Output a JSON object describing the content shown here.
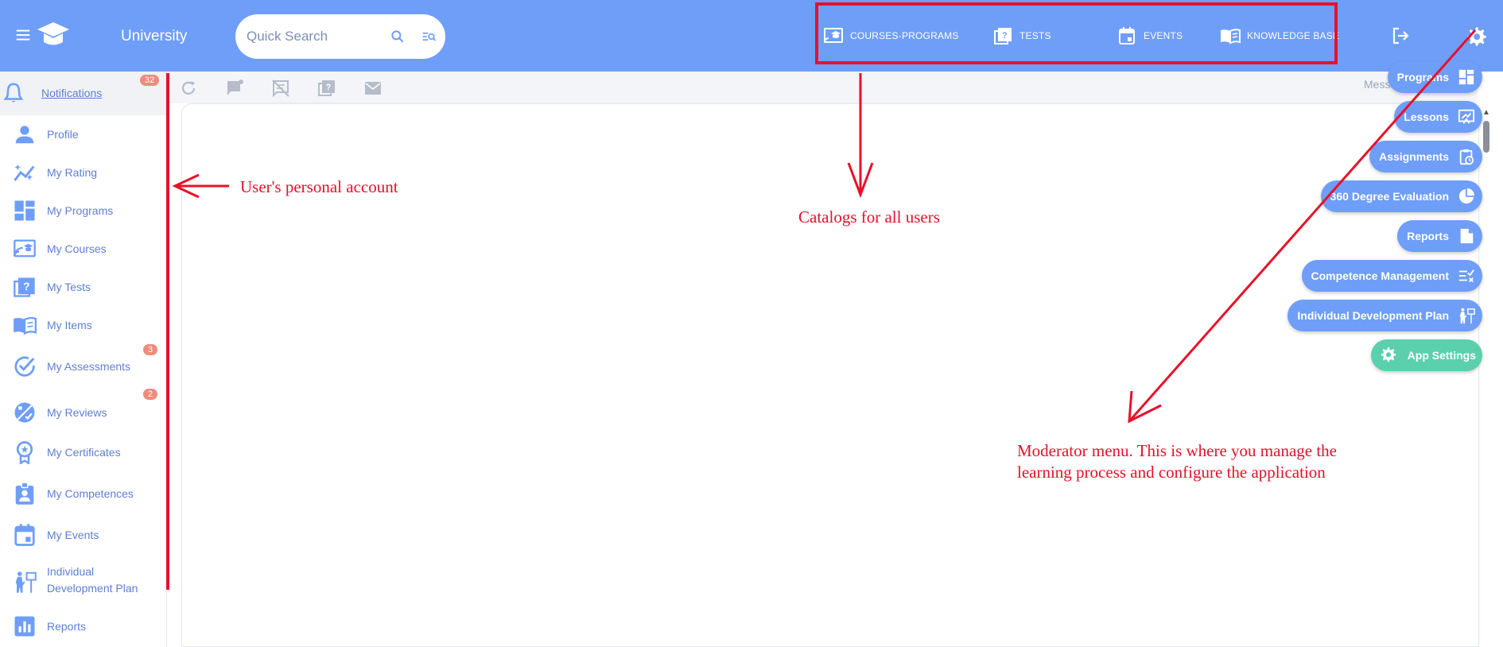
{
  "app": {
    "title": "University"
  },
  "search": {
    "placeholder": "Quick Search"
  },
  "nav": [
    {
      "label": "COURSES-PROGRAMS",
      "icon": "cast-education-icon"
    },
    {
      "label": "TESTS",
      "icon": "quiz-icon"
    },
    {
      "label": "EVENTS",
      "icon": "calendar-icon"
    },
    {
      "label": "KNOWLEDGE BASE",
      "icon": "book-icon"
    }
  ],
  "sidebar": {
    "items": [
      {
        "label": "Notifications",
        "icon": "bell-icon",
        "badge": "32"
      },
      {
        "label": "Profile",
        "icon": "person-icon"
      },
      {
        "label": "My Rating",
        "icon": "rating-chart-icon"
      },
      {
        "label": "My Programs",
        "icon": "dashboard-icon"
      },
      {
        "label": "My Courses",
        "icon": "cast-education-icon"
      },
      {
        "label": "My Tests",
        "icon": "quiz-icon"
      },
      {
        "label": "My Items",
        "icon": "book-icon"
      },
      {
        "label": "My Assessments",
        "icon": "check-circle-icon",
        "badge": "3"
      },
      {
        "label": "My Reviews",
        "icon": "review-icon",
        "badge": "2"
      },
      {
        "label": "My Certificates",
        "icon": "certificate-icon"
      },
      {
        "label": "My Competences",
        "icon": "badge-icon"
      },
      {
        "label": "My Events",
        "icon": "calendar-icon"
      },
      {
        "label_line1": "Individual",
        "label_line2": "Development Plan",
        "icon": "development-plan-icon"
      },
      {
        "label": "Reports",
        "icon": "reports-icon"
      }
    ]
  },
  "toolbar": {
    "messages_cut": "Messa"
  },
  "moderator_menu": [
    {
      "label": "Programs",
      "icon": "dashboard-icon"
    },
    {
      "label": "Lessons",
      "icon": "lesson-icon"
    },
    {
      "label": "Assignments",
      "icon": "assignment-icon"
    },
    {
      "label": "360 Degree Evaluation",
      "icon": "pie-chart-icon"
    },
    {
      "label": "Reports",
      "icon": "report-doc-icon"
    },
    {
      "label": "Competence Management",
      "icon": "checklist-icon"
    },
    {
      "label": "Individual Development Plan",
      "icon": "development-plan-icon"
    },
    {
      "label": "App Settings",
      "icon": "gear-icon"
    }
  ],
  "annotations": {
    "personal": "User's personal account",
    "catalogs": "Catalogs for all users",
    "moderator_line1": "Moderator menu. This is where you manage the",
    "moderator_line2": "learning process and configure the application"
  },
  "colors": {
    "topbar": "#6f9ef8",
    "accent_text": "#5e7fd4",
    "badge": "#f08b7b",
    "green": "#5bd0ad",
    "annotation": "#e8102a"
  }
}
